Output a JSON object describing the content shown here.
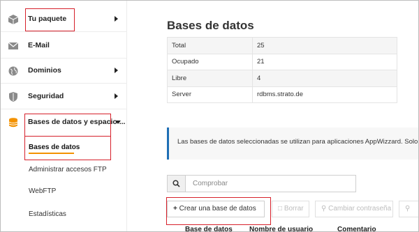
{
  "sidebar": {
    "items": [
      {
        "label": "Tu paquete",
        "icon": "package-icon"
      },
      {
        "label": "E-Mail",
        "icon": "envelope-icon"
      },
      {
        "label": "Dominios",
        "icon": "globe-icon"
      },
      {
        "label": "Seguridad",
        "icon": "shield-icon"
      },
      {
        "label": "Bases de datos y espacio ...",
        "icon": "database-icon"
      }
    ],
    "subitems": [
      {
        "label": "Bases de datos"
      },
      {
        "label": "Administrar accesos FTP"
      },
      {
        "label": "WebFTP"
      },
      {
        "label": "Estadísticas"
      }
    ]
  },
  "main": {
    "title": "Bases de datos",
    "info": [
      {
        "key": "Total",
        "value": "25"
      },
      {
        "key": "Ocupado",
        "value": "21"
      },
      {
        "key": "Libre",
        "value": "4"
      },
      {
        "key": "Server",
        "value": "rdbms.strato.de"
      }
    ],
    "notice": "Las bases de datos seleccionadas se utilizan para aplicaciones AppWizzard. Solo es",
    "search": {
      "placeholder": "Comprobar"
    },
    "toolbar": {
      "create": "Crear una base de datos",
      "delete": "Borrar",
      "change_password": "Cambiar contraseña"
    },
    "columns": [
      "Base de datos",
      "Nombre de usuario",
      "Comentario"
    ]
  },
  "colors": {
    "accent_orange": "#f39200",
    "highlight_red": "#d6202a",
    "notice_blue": "#1f6fb5"
  }
}
